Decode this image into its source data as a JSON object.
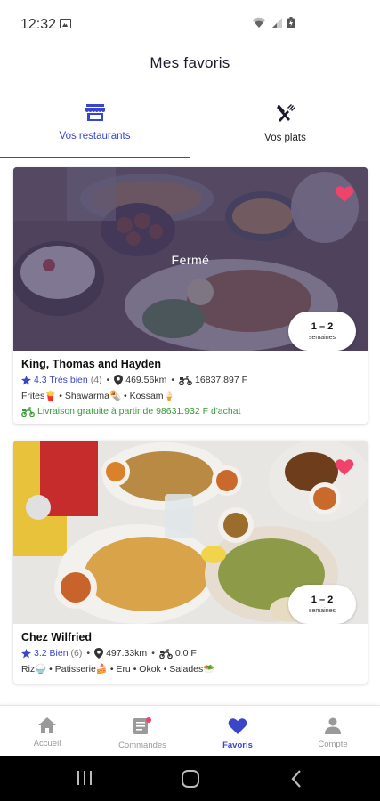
{
  "status": {
    "time": "12:32"
  },
  "header": {
    "title": "Mes favoris"
  },
  "tabs": [
    {
      "label": "Vos restaurants",
      "icon": "store-icon",
      "active": true
    },
    {
      "label": "Vos plats",
      "icon": "fork-knife-icon",
      "active": false
    }
  ],
  "restaurants": [
    {
      "name": "King, Thomas and Hayden",
      "status_label": "Fermé",
      "rating": "4.3 Très bien",
      "rating_count": "(4)",
      "distance": "469.56km",
      "delivery_fee": "16837.897 F",
      "categories": "Frites🍟 • Shawarma🌯 • Kossam🍦",
      "promo": "Livraison gratuite à partir de 98631.932 F d'achat",
      "delay_main": "1 – 2",
      "delay_sub": "semaines",
      "favorite": true
    },
    {
      "name": "Chez Wilfried",
      "rating": "3.2 Bien",
      "rating_count": "(6)",
      "distance": "497.33km",
      "delivery_fee": "0.0 F",
      "categories": "Riz🍚 • Patisserie🍰 • Eru • Okok • Salades🥗",
      "delay_main": "1 – 2",
      "delay_sub": "semaines",
      "favorite": true
    }
  ],
  "bottom_nav": [
    {
      "label": "Accueil",
      "icon": "home-icon",
      "active": false
    },
    {
      "label": "Commandes",
      "icon": "orders-icon",
      "active": false
    },
    {
      "label": "Favoris",
      "icon": "heart-icon",
      "active": true
    },
    {
      "label": "Compte",
      "icon": "user-icon",
      "active": false
    }
  ],
  "colors": {
    "accent": "#3a46c9",
    "heart": "#f0436b",
    "promo": "#3a9a3a"
  }
}
